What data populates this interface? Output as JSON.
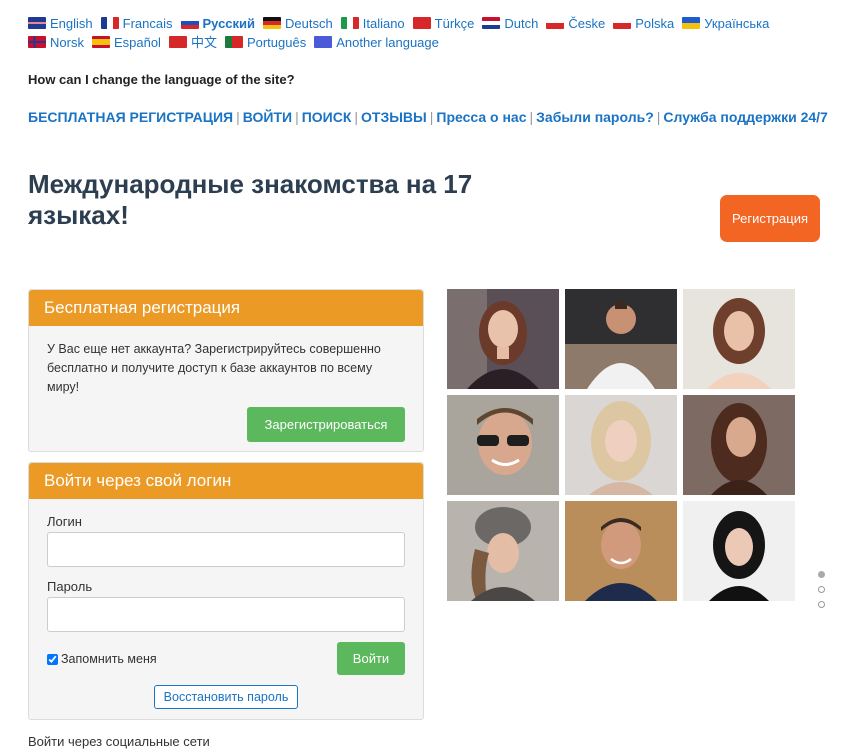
{
  "languages": [
    {
      "label": "English",
      "flag": "uk-flag-icon",
      "active": false
    },
    {
      "label": "Francais",
      "flag": "fr-flag-icon",
      "active": false
    },
    {
      "label": "Русский",
      "flag": "ru-flag-icon",
      "active": true
    },
    {
      "label": "Deutsch",
      "flag": "de-flag-icon",
      "active": false
    },
    {
      "label": "Italiano",
      "flag": "it-flag-icon",
      "active": false
    },
    {
      "label": "Türkçe",
      "flag": "tr-flag-icon",
      "active": false
    },
    {
      "label": "Dutch",
      "flag": "nl-flag-icon",
      "active": false
    },
    {
      "label": "Česke",
      "flag": "cz-flag-icon",
      "active": false
    },
    {
      "label": "Polska",
      "flag": "pl-flag-icon",
      "active": false
    },
    {
      "label": "Українська",
      "flag": "ua-flag-icon",
      "active": false
    },
    {
      "label": "Norsk",
      "flag": "no-flag-icon",
      "active": false
    },
    {
      "label": "Español",
      "flag": "es-flag-icon",
      "active": false
    },
    {
      "label": "中文",
      "flag": "cn-flag-icon",
      "active": false
    },
    {
      "label": "Português",
      "flag": "pt-flag-icon",
      "active": false
    },
    {
      "label": "Another language",
      "flag": "other-language-icon",
      "active": false
    }
  ],
  "help_link": "How can I change the language of the site?",
  "nav": [
    "БЕСПЛАТНАЯ РЕГИСТРАЦИЯ",
    "ВОЙТИ",
    "ПОИСК",
    "ОТЗЫВЫ",
    "Пресса о нас",
    "Забыли пароль?",
    "Служба поддержки 24/7"
  ],
  "headline": "Международные знакомства на 17 языках!",
  "register_button": "Регистрация",
  "free_registration": {
    "title": "Бесплатная регистрация",
    "text": "У Вас еще нет аккаунта? Зарегистрируйтесь совершенно бесплатно и получите доступ к базе аккаунтов по всему миру!",
    "button": "Зарегистрироваться"
  },
  "login": {
    "title": "Войти через свой логин",
    "login_label": "Логин",
    "login_value": "",
    "password_label": "Пароль",
    "password_value": "",
    "remember_label": "Запомнить меня",
    "remember_checked": true,
    "submit": "Войти",
    "restore": "Восстановить пароль"
  },
  "social_login": "Войти через социальные сети",
  "carousel": {
    "slides": 3,
    "active": 0
  },
  "colors": {
    "link": "#1a73c4",
    "panel_header": "#ec9a26",
    "register_button": "#f26522",
    "green_button": "#5cb85c",
    "headline": "#2c3e50"
  }
}
